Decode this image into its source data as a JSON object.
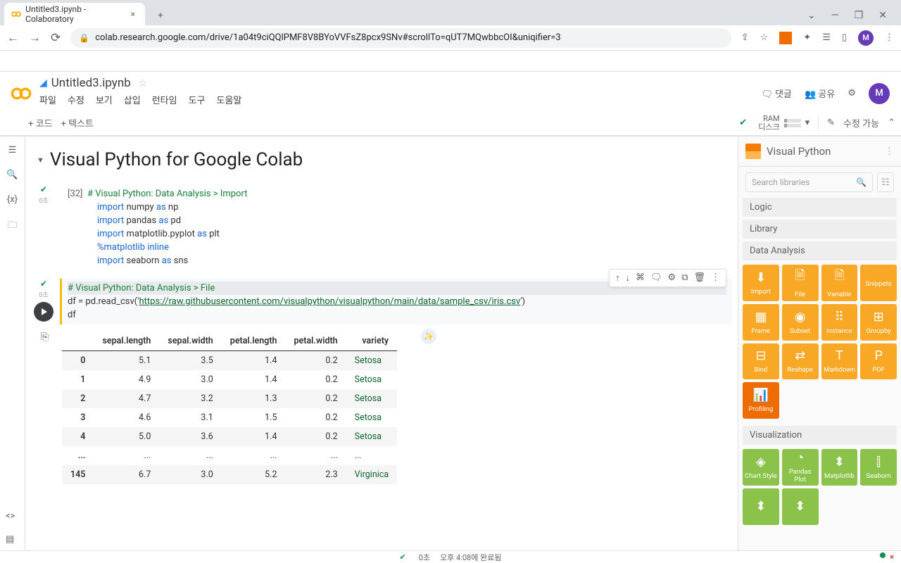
{
  "browser": {
    "tab_title": "Untitled3.ipynb - Colaboratory",
    "url": "colab.research.google.com/drive/1a04t9ciQQlPMF8V8BYoVVFsZ8pcx9SNv#scrollTo=qUT7MQwbbcOI&uniqifier=3",
    "avatar_letter": "M"
  },
  "colab": {
    "doc_title": "Untitled3.ipynb",
    "menus": [
      "파일",
      "수정",
      "보기",
      "삽입",
      "런타임",
      "도구",
      "도움말"
    ],
    "comment_label": "댓글",
    "share_label": "공유",
    "add_code": "+ 코드",
    "add_text": "+ 텍스트",
    "ram_label": "RAM",
    "disk_label": "디스크",
    "edit_mode": "수정 가능"
  },
  "heading": "Visual Python for Google Colab",
  "cell1": {
    "exec": "[32]",
    "time": "0초",
    "comment": "# Visual Python: Data Analysis > Import",
    "l2a": "import",
    "l2b": "numpy",
    "l2c": "as",
    "l2d": "np",
    "l3a": "import",
    "l3b": "pandas",
    "l3c": "as",
    "l3d": "pd",
    "l4a": "import",
    "l4b": "matplotlib.pyplot",
    "l4c": "as",
    "l4d": "plt",
    "l5": "%matplotlib inline",
    "l6a": "import",
    "l6b": "seaborn",
    "l6c": "as",
    "l6d": "sns"
  },
  "cell2": {
    "comment": "# Visual Python: Data Analysis > File",
    "pre": "df = pd.read_csv('",
    "url": "https://raw.githubusercontent.com/visualpython/visualpython/main/data/sample_csv/iris.csv",
    "post": "')",
    "l3": "df",
    "time": "0초"
  },
  "table": {
    "cols": [
      "",
      "sepal.length",
      "sepal.width",
      "petal.length",
      "petal.width",
      "variety"
    ],
    "rows": [
      [
        "0",
        "5.1",
        "3.5",
        "1.4",
        "0.2",
        "Setosa"
      ],
      [
        "1",
        "4.9",
        "3.0",
        "1.4",
        "0.2",
        "Setosa"
      ],
      [
        "2",
        "4.7",
        "3.2",
        "1.3",
        "0.2",
        "Setosa"
      ],
      [
        "3",
        "4.6",
        "3.1",
        "1.5",
        "0.2",
        "Setosa"
      ],
      [
        "4",
        "5.0",
        "3.6",
        "1.4",
        "0.2",
        "Setosa"
      ],
      [
        "...",
        "...",
        "...",
        "...",
        "...",
        "..."
      ],
      [
        "145",
        "6.7",
        "3.0",
        "5.2",
        "2.3",
        "Virginica"
      ]
    ]
  },
  "vp": {
    "title": "Visual Python",
    "search_placeholder": "Search libraries",
    "sections": {
      "logic": "Logic",
      "library": "Library",
      "data": "Data Analysis",
      "viz": "Visualization"
    },
    "data_tiles": [
      "Import",
      "File",
      "Variable",
      "Snippets",
      "Frame",
      "Subset",
      "Instance",
      "Groupby",
      "Bind",
      "Reshape",
      "Markdown",
      "PDF",
      "Profiling"
    ],
    "viz_tiles": [
      "Chart Style",
      "Pandas Plot",
      "Matplotlib",
      "Seaborn"
    ]
  },
  "status": {
    "time": "0초",
    "loaded": "오후 4:08에 완료됨"
  }
}
